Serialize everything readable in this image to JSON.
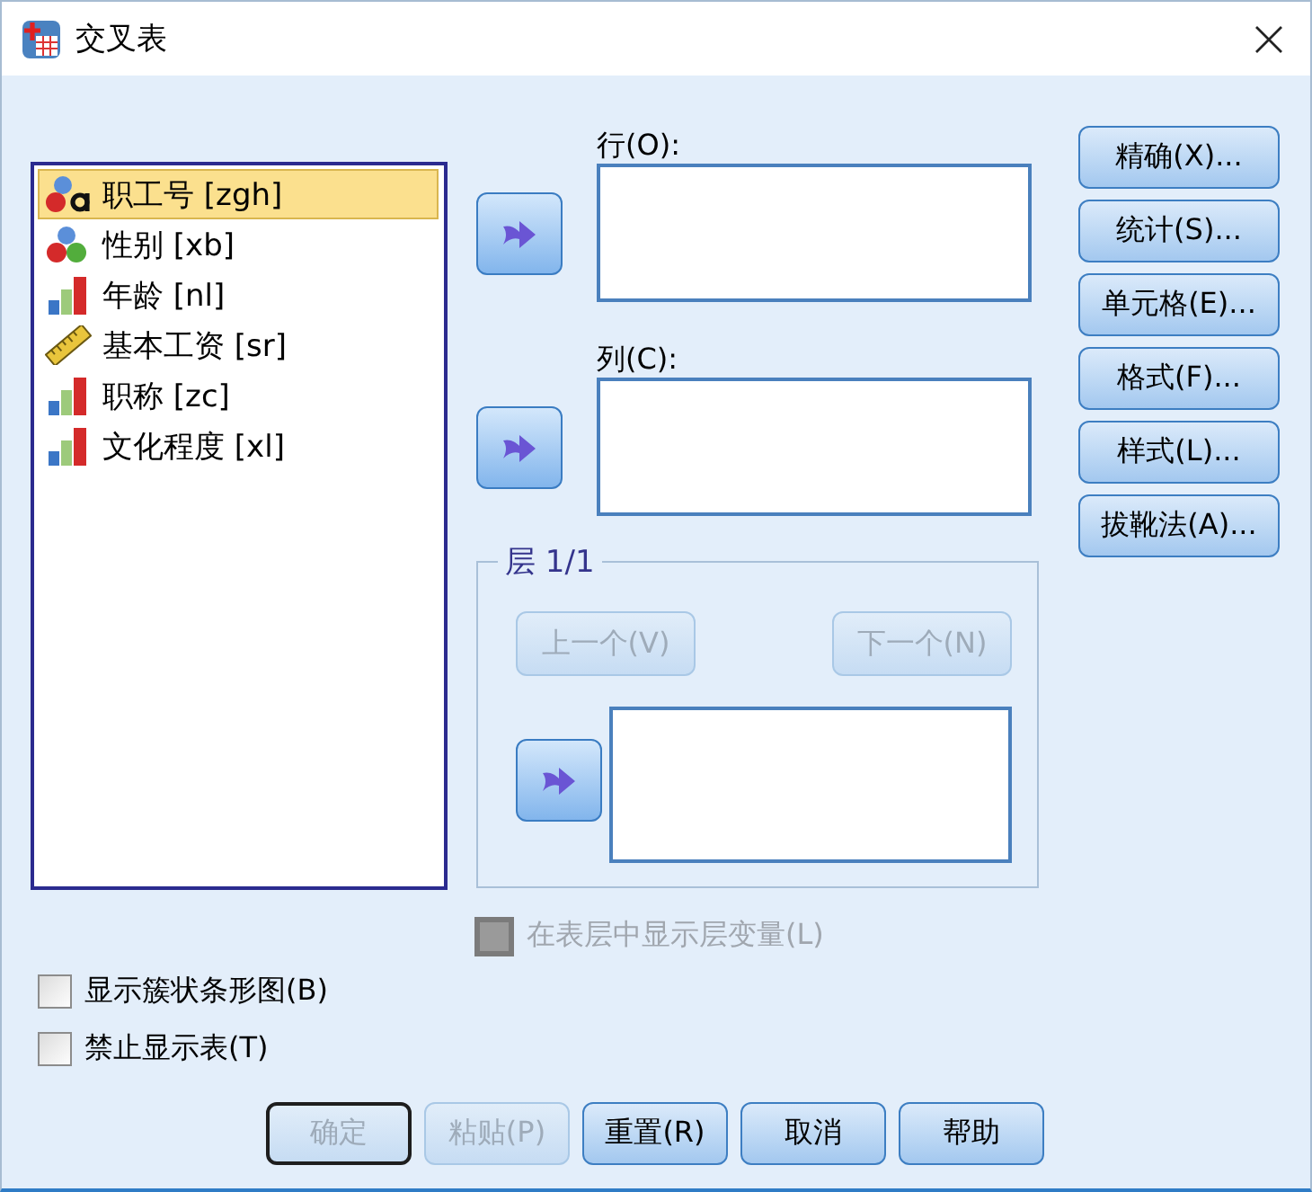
{
  "window": {
    "title": "交叉表"
  },
  "variables": [
    {
      "label": "职工号 [zgh]",
      "kind": "string",
      "selected": true
    },
    {
      "label": "性别 [xb]",
      "kind": "nominal",
      "selected": false
    },
    {
      "label": "年龄 [nl]",
      "kind": "ordinal",
      "selected": false
    },
    {
      "label": "基本工资 [sr]",
      "kind": "scale",
      "selected": false
    },
    {
      "label": "职称 [zc]",
      "kind": "ordinal",
      "selected": false
    },
    {
      "label": "文化程度 [xl]",
      "kind": "ordinal",
      "selected": false
    }
  ],
  "row_field": {
    "label": "行(O):"
  },
  "column_field": {
    "label": "列(C):"
  },
  "layer": {
    "title": "层 1/1",
    "previous_button": {
      "label": "上一个(V)",
      "disabled": true
    },
    "next_button": {
      "label": "下一个(N)",
      "disabled": true
    }
  },
  "layer_option": {
    "label": "在表层中显示层变量(L)",
    "checked": false,
    "disabled": true
  },
  "options": [
    {
      "label": "显示簇状条形图(B)",
      "checked": false
    },
    {
      "label": "禁止显示表(T)",
      "checked": false
    }
  ],
  "side_buttons": [
    "精确(X)...",
    "统计(S)...",
    "单元格(E)...",
    "格式(F)...",
    "样式(L)...",
    "拔靴法(A)..."
  ],
  "buttons": [
    {
      "label": "确定",
      "disabled": true,
      "focused": true
    },
    {
      "label": "粘贴(P)",
      "disabled": true,
      "focused": false
    },
    {
      "label": "重置(R)",
      "disabled": false,
      "focused": false
    },
    {
      "label": "取消",
      "disabled": false,
      "focused": false
    },
    {
      "label": "帮助",
      "disabled": false,
      "focused": false
    }
  ]
}
